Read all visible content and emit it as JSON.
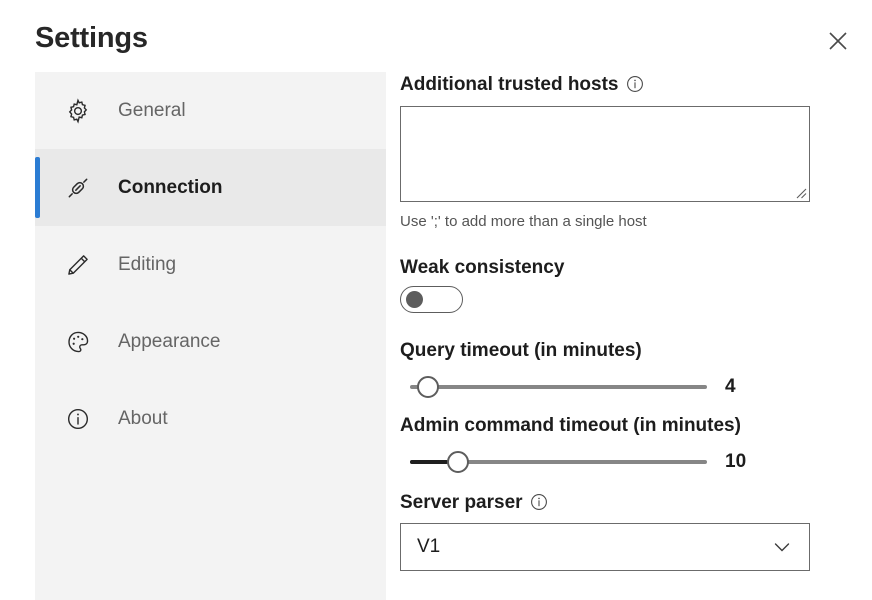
{
  "window": {
    "title": "Settings",
    "close_label": "Close",
    "close_icon": "close-icon"
  },
  "sidebar": {
    "items": [
      {
        "label": "General",
        "icon": "gear-icon",
        "selected": false
      },
      {
        "label": "Connection",
        "icon": "plug-icon",
        "selected": true
      },
      {
        "label": "Editing",
        "icon": "pencil-icon",
        "selected": false
      },
      {
        "label": "Appearance",
        "icon": "palette-icon",
        "selected": false
      },
      {
        "label": "About",
        "icon": "info-circle-icon",
        "selected": false
      }
    ],
    "accent_color": "#2b7cd3",
    "selected_bg": "#e9e9e9",
    "panel_bg": "#f3f3f3"
  },
  "main": {
    "trusted_hosts": {
      "label": "Additional trusted hosts",
      "info_icon": "info-icon",
      "value": "",
      "placeholder": "",
      "hint": "Use ';' to add more than a single host",
      "resize_icon": "resize-grip-icon"
    },
    "weak_consistency": {
      "label": "Weak consistency",
      "state": "off",
      "toggle_icon": "toggle-switch-icon"
    },
    "query_timeout": {
      "label": "Query timeout (in minutes)",
      "value": "4",
      "percent": 0
    },
    "admin_timeout": {
      "label": "Admin command timeout (in minutes)",
      "value": "10",
      "percent": 11
    },
    "server_parser": {
      "label": "Server parser",
      "info_icon": "info-icon",
      "selected": "V1",
      "chevron_icon": "chevron-down-icon"
    }
  }
}
